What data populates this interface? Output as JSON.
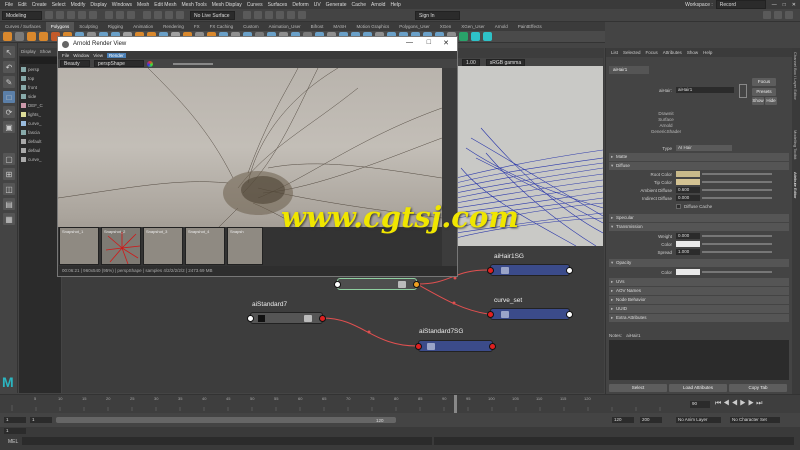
{
  "menubar": {
    "items": [
      "File",
      "Edit",
      "Create",
      "Select",
      "Modify",
      "Display",
      "Windows",
      "Mesh",
      "Edit Mesh",
      "Mesh Tools",
      "Mesh Display",
      "Curves",
      "Surfaces",
      "Deform",
      "UV",
      "Generate",
      "Cache",
      "Arnold",
      "Help"
    ],
    "workspace_label": "Workspace :",
    "workspace_value": "Record"
  },
  "statusline": {
    "mode": "Modeling",
    "live_surface": "No Live Surface",
    "sign_in": "Sign In"
  },
  "shelf": {
    "tabs": [
      "Curves / Surfaces",
      "Polygons",
      "Sculpting",
      "Rigging",
      "Animation",
      "Rendering",
      "FX",
      "FX Caching",
      "Custom",
      "Animation_User",
      "Bifrost",
      "MASH",
      "Motion Graphics",
      "Polygons_User",
      "XGen",
      "XGen_User",
      "Arnold",
      "PaintEffects"
    ],
    "active_tab": "Polygons",
    "icon_colors": [
      "#d9882d",
      "#7a7a7a",
      "#d9882d",
      "#d9882d",
      "#c45a2a",
      "#d9882d",
      "#6aa0c8",
      "#8f8f8f",
      "#6aa0c8",
      "#6aa0c8",
      "#a0a0a0",
      "#d9882d",
      "#d9882d",
      "#6aa0c8",
      "#a0a0a0",
      "#d9882d",
      "#8f8f8f",
      "#d9882d",
      "#6aa0c8",
      "#8f8f8f",
      "#6aa0c8",
      "#7a7a7a",
      "#6aa0c8",
      "#8f8f8f",
      "#6aa0c8",
      "#7a7a7a",
      "#6aa0c8",
      "#8f8f8f",
      "#6aa0c8",
      "#6aa0c8",
      "#6aa0c8",
      "#8f8f8f",
      "#6aa0c8",
      "#6aa0c8",
      "#6aa0c8",
      "#6aa0c8",
      "#6aa0c8",
      "#8f8f8f",
      "#29a36a",
      "#2ec2c8",
      "#2ec2c8"
    ]
  },
  "outliner": {
    "tabs": [
      "Display",
      "Show"
    ],
    "search_placeholder": "Search...",
    "items": [
      "persp",
      "top",
      "front",
      "side",
      "DEF_C",
      "lights_",
      "curve_",
      "fascia",
      "default",
      "defaul",
      "curve_"
    ]
  },
  "render_view": {
    "title": "Arnold Render View",
    "menu": [
      "File",
      "Window",
      "View",
      "Render"
    ],
    "highlighted_menu": "Render",
    "toolbar": {
      "aov": "Beauty",
      "camera": "perspShape",
      "zoom": "1.00",
      "color_space": "sRGB gamma"
    },
    "snapshots": [
      "Snapshot_1",
      "Snapshot_2",
      "Snapshot_3",
      "Snapshot_4",
      "Snapsh"
    ],
    "status": "00:06:21 | 960x540 (95%) | perspShape | samples 4/2/2/2/2/2 | 2473.69 MB"
  },
  "nodes": [
    {
      "name": "aiHair1SG",
      "type": "blue"
    },
    {
      "name": "curve_set",
      "type": "blue"
    },
    {
      "name": "aiStandard7",
      "type": "dark"
    },
    {
      "name": "aiStandard7SG",
      "type": "blue"
    },
    {
      "name": "",
      "type": "grey"
    }
  ],
  "attribute_editor": {
    "menu": [
      "List",
      "Selected",
      "Focus",
      "Attributes",
      "Show",
      "Help"
    ],
    "tab": "aiHair1",
    "node_label": "aiHair:",
    "node_name": "aiHair1",
    "buttons": {
      "focus": "Focus",
      "presets": "Presets",
      "show": "Show",
      "hide": "Hide"
    },
    "description": [
      "Drawnit",
      "Surface",
      "Arnold",
      "GenericShader"
    ],
    "type_label": "Type",
    "type_value": "AI Hair",
    "sections": {
      "matte": "Matte",
      "diffuse": "Diffuse",
      "specular": "Specular",
      "transmission": "Transmission",
      "opacity": "Opacity",
      "uvs": "UVs",
      "aov_names": "AOV Names",
      "node_behavior": "Node Behavior",
      "uuid": "UUID",
      "extra": "Extra Attributes"
    },
    "diffuse": {
      "root_color": "Root Color",
      "tip_color": "Tip Color",
      "ambient_diffuse": "Ambient Diffuse",
      "ambient_diffuse_val": "0.600",
      "indirect_diffuse": "Indirect Diffuse",
      "indirect_diffuse_val": "0.000",
      "diffuse_cache": "Diffuse Cache"
    },
    "transmission": {
      "weight": "Weight",
      "weight_val": "0.000",
      "color": "Color",
      "spread": "Spread",
      "spread_val": "1.000"
    },
    "opacity": {
      "color": "Color"
    },
    "notes_label": "Notes:",
    "notes_value": "aiHair1",
    "bottom_buttons": [
      "Select",
      "Load Attributes",
      "Copy Tab"
    ],
    "colors": {
      "root": "#c8b98a",
      "tip": "#d4c393",
      "trans": "#e9e9e9",
      "opacity": "#e9e9e9"
    }
  },
  "right_tabs": [
    "Channel Box / Layer Editor",
    "Modelling Toolkit",
    "Attribute Editor"
  ],
  "timeline": {
    "ticks": [
      "5",
      "10",
      "15",
      "20",
      "25",
      "30",
      "35",
      "40",
      "45",
      "50",
      "55",
      "60",
      "65",
      "70",
      "75",
      "80",
      "85",
      "90",
      "95",
      "100",
      "105",
      "110",
      "115",
      "120"
    ],
    "current_frame": "90"
  },
  "range": {
    "start": "1",
    "start_inner": "1",
    "end_inner": "120",
    "end": "120",
    "max": "200",
    "anim_layer": "No Anim Layer",
    "char_set": "No Character Set",
    "frame": "1"
  },
  "mel": {
    "label": "MEL"
  },
  "watermark": "www.cgtsj.com"
}
